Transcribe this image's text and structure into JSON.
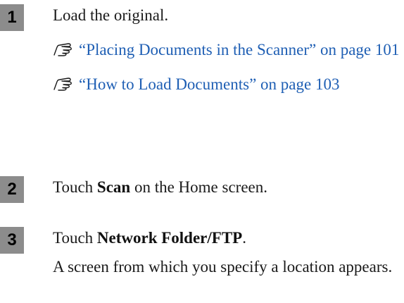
{
  "steps": [
    {
      "number": "1",
      "text": "Load the original.",
      "references": [
        {
          "icon": "pointing-hand-icon",
          "link_text": "“Placing Documents in the Scanner” on page 101"
        },
        {
          "icon": "pointing-hand-icon",
          "link_text": "“How to Load Documents” on page 103"
        }
      ]
    },
    {
      "number": "2",
      "text_before": "Touch ",
      "bold": "Scan",
      "text_after": " on the Home screen."
    },
    {
      "number": "3",
      "text_before": "Touch ",
      "bold": "Network Folder/FTP",
      "text_after": ".",
      "note": "A screen from which you specify a location appears."
    }
  ],
  "colors": {
    "step_box": "#8c8c8c",
    "link": "#1f5fb4",
    "text": "#1a1a1a"
  }
}
